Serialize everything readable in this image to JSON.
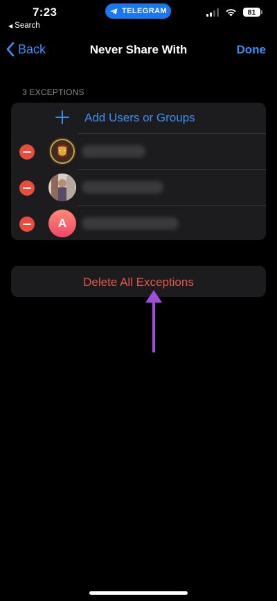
{
  "status_bar": {
    "time": "7:23",
    "back_app": "Search",
    "app_pill": "TELEGRAM",
    "battery": "81"
  },
  "nav": {
    "back_label": "Back",
    "title": "Never Share With",
    "done_label": "Done"
  },
  "exceptions": {
    "header": "3 EXCEPTIONS",
    "add_label": "Add Users or Groups",
    "users": [
      {
        "avatar": "ironman-avatar"
      },
      {
        "avatar": "photo-avatar"
      },
      {
        "avatar_letter": "A"
      }
    ]
  },
  "delete_all_label": "Delete All Exceptions",
  "colors": {
    "accent": "#3a8ff7",
    "destructive": "#e8544a",
    "remove_badge": "#eb4d3d",
    "annotation": "#a04ddc",
    "background": "#000000",
    "group_bg": "#1c1c1e"
  }
}
